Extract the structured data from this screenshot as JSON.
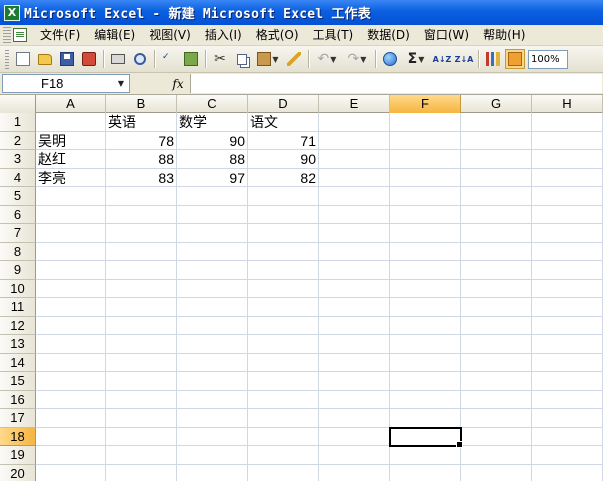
{
  "window": {
    "title": "Microsoft Excel - 新建 Microsoft Excel 工作表",
    "app_icon_glyph": "X"
  },
  "menu": {
    "items": [
      "文件(F)",
      "编辑(E)",
      "视图(V)",
      "插入(I)",
      "格式(O)",
      "工具(T)",
      "数据(D)",
      "窗口(W)",
      "帮助(H)"
    ]
  },
  "toolbar": {
    "icons": [
      "new-icon",
      "open-icon",
      "save-icon",
      "permission-icon",
      "print-icon",
      "print-preview-icon",
      "spelling-icon",
      "research-icon",
      "cut-icon",
      "copy-icon",
      "paste-icon",
      "format-painter-icon",
      "undo-icon",
      "redo-icon",
      "hyperlink-icon",
      "autosum-icon",
      "sort-ascending-icon",
      "sort-descending-icon",
      "chart-wizard-icon",
      "drawing-icon"
    ],
    "autosum_glyph": "Σ",
    "sort_asc_glyph": "A↓Z",
    "sort_desc_glyph": "Z↓A",
    "zoom": "100%"
  },
  "formula_bar": {
    "name_box": "F18",
    "fx_label": "fx",
    "value": ""
  },
  "sheet": {
    "columns": [
      "A",
      "B",
      "C",
      "D",
      "E",
      "F",
      "G",
      "H"
    ],
    "active_column": "F",
    "active_row": 18,
    "rows": [
      [
        "",
        "英语",
        "数学",
        "语文",
        "",
        "",
        "",
        ""
      ],
      [
        "吴明",
        "78",
        "90",
        "71",
        "",
        "",
        "",
        ""
      ],
      [
        "赵红",
        "88",
        "88",
        "90",
        "",
        "",
        "",
        ""
      ],
      [
        "李亮",
        "83",
        "97",
        "82",
        "",
        "",
        "",
        ""
      ]
    ],
    "row_count": 20
  },
  "colors": {
    "titlebar": "#0a5fe0",
    "active_header": "#f5b541",
    "gridline": "#d0d7e5"
  }
}
